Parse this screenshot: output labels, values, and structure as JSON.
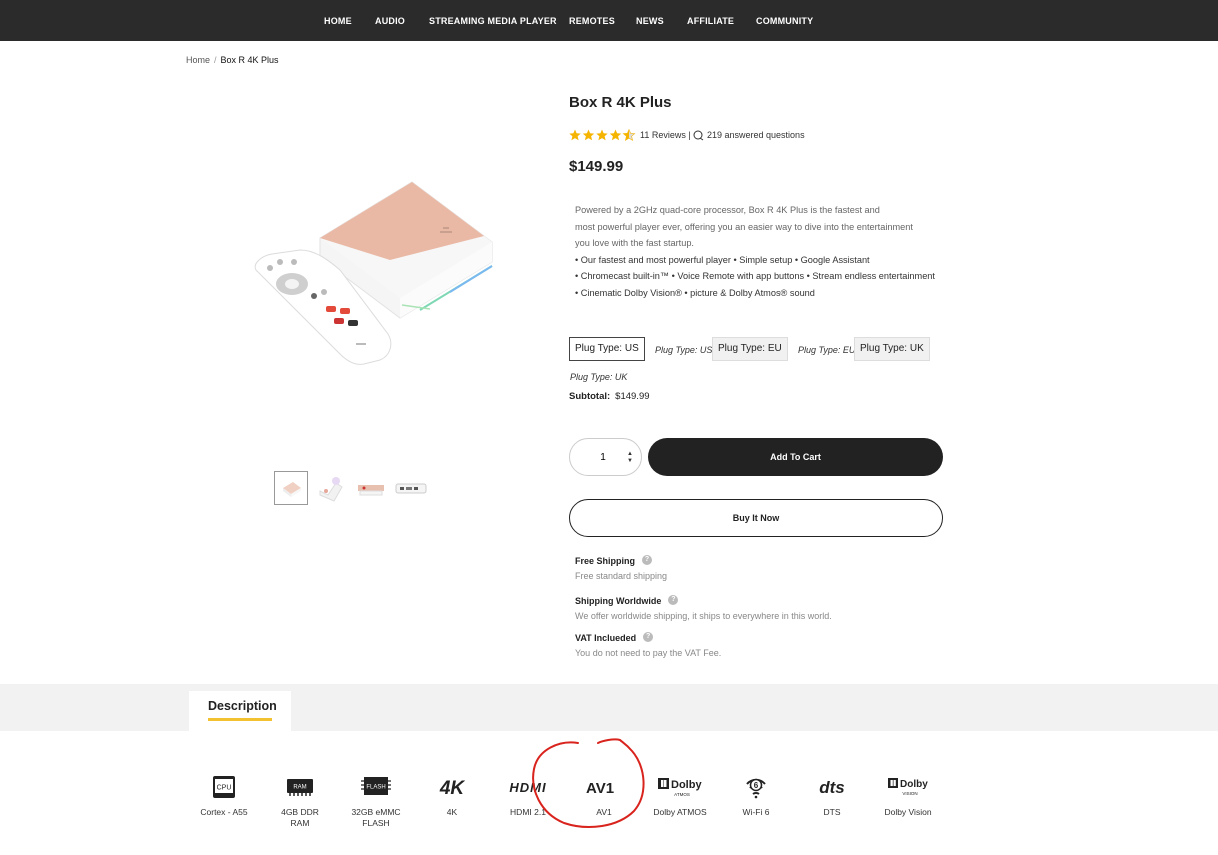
{
  "nav": {
    "items": [
      "HOME",
      "AUDIO",
      "STREAMING MEDIA PLAYER",
      "REMOTES",
      "NEWS",
      "AFFILIATE",
      "COMMUNITY"
    ]
  },
  "breadcrumb": {
    "home": "Home",
    "current": "Box R 4K Plus"
  },
  "product": {
    "title": "Box R 4K Plus",
    "rating": 4.5,
    "reviews": "11 Reviews |",
    "questions": "219 answered questions",
    "price": "$149.99",
    "description": {
      "intro_lines": [
        "Powered by a 2GHz quad-core processor, Box R 4K Plus is the fastest and",
        "most powerful player ever, offering you an easier way to dive into the entertainment",
        "you love with the fast startup."
      ],
      "bullets": [
        "• Our fastest and most powerful player • Simple setup • Google Assistant",
        "• Chromecast built-in™ • Voice Remote with app buttons • Stream endless entertainment",
        "• Cinematic Dolby Vision® • picture & Dolby Atmos® sound"
      ]
    },
    "plug_options": [
      {
        "label": "Plug Type: US",
        "note": "Plug Type: US",
        "selected": true
      },
      {
        "label": "Plug Type: EU",
        "note": "Plug Type: EU",
        "selected": false
      },
      {
        "label": "Plug Type: UK",
        "note": "Plug Type: UK",
        "selected": false
      }
    ],
    "subtotal_label": "Subtotal:",
    "subtotal_value": "$149.99",
    "quantity": "1",
    "add_to_cart": "Add To Cart",
    "buy_now": "Buy It Now"
  },
  "info": [
    {
      "title": "Free Shipping",
      "text": "Free standard shipping"
    },
    {
      "title": "Shipping Worldwide",
      "text": "We offer worldwide shipping, it ships to everywhere in this world."
    },
    {
      "title": "VAT Inclueded",
      "text": "You do not need to pay the VAT Fee."
    }
  ],
  "tabs": {
    "description": "Description"
  },
  "features": [
    {
      "icon": "cpu-icon",
      "glyph": "CPU",
      "label": "Cortex - A55"
    },
    {
      "icon": "ram-icon",
      "glyph": "RAM",
      "label": "4GB DDR RAM"
    },
    {
      "icon": "flash-icon",
      "glyph": "FLASH",
      "label": "32GB eMMC FLASH"
    },
    {
      "icon": "4k-icon",
      "glyph": "4K",
      "label": "4K"
    },
    {
      "icon": "hdmi-icon",
      "glyph": "HDMI",
      "label": "HDMI 2.1"
    },
    {
      "icon": "av1-icon",
      "glyph": "AV1",
      "label": "AV1"
    },
    {
      "icon": "dolby-atmos-icon",
      "glyph": "Dolby",
      "sub": "ATMOS",
      "label": "Dolby ATMOS"
    },
    {
      "icon": "wifi6-icon",
      "glyph": "6",
      "label": "Wi-Fi 6"
    },
    {
      "icon": "dts-icon",
      "glyph": "dts",
      "label": "DTS"
    },
    {
      "icon": "dolby-vision-icon",
      "glyph": "Dolby",
      "sub": "VISION",
      "label": "Dolby Vision"
    }
  ],
  "colors": {
    "nav_bg": "#2b2b2b",
    "accent_yellow": "#f2c230",
    "star": "#f4b400",
    "button_dark": "#222222",
    "annotation_red": "#d9231d",
    "box_top": "#e9b9a6"
  }
}
